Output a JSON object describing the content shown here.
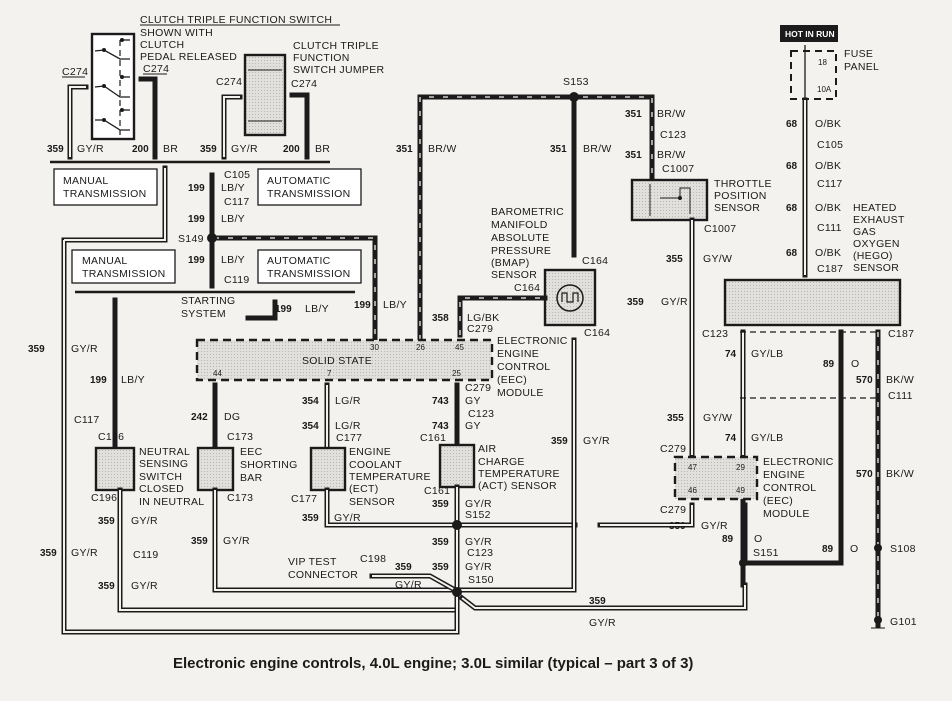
{
  "title": "Electronic engine controls, 4.0L engine; 3.0L similar (typical – part 3 of 3)",
  "hot_in_run": "HOT IN RUN",
  "fuse_panel": {
    "line1": "FUSE",
    "line2": "PANEL",
    "fuse_num": "18",
    "fuse_amps": "10A"
  },
  "clutch_switch": {
    "title": "CLUTCH TRIPLE FUNCTION SWITCH",
    "note": [
      "SHOWN WITH",
      "CLUTCH",
      "PEDAL RELEASED"
    ],
    "conn_left": "C274",
    "conn_right": "C274"
  },
  "clutch_jumper": {
    "title": [
      "CLUTCH TRIPLE",
      "FUNCTION",
      "SWITCH JUMPER"
    ],
    "conn_left": "C274",
    "conn_right": "C274"
  },
  "wires_top": {
    "w1_num": "359",
    "w1_color": "GY/R",
    "w2_num": "200",
    "w2_color": "BR",
    "w3_num": "359",
    "w3_color": "GY/R",
    "w4_num": "200",
    "w4_color": "BR"
  },
  "transmission_boxes": {
    "manual_1": [
      "MANUAL",
      "TRANSMISSION"
    ],
    "auto_1": [
      "AUTOMATIC",
      "TRANSMISSION"
    ],
    "manual_2": [
      "MANUAL",
      "TRANSMISSION"
    ],
    "auto_2": [
      "AUTOMATIC",
      "TRANSMISSION"
    ]
  },
  "circuit_199": {
    "num": "199",
    "color": "LB/Y",
    "c105": "C105",
    "c117": "C117",
    "s149": "S149",
    "c119": "C119",
    "starting_system": [
      "STARTING",
      "SYSTEM"
    ]
  },
  "circuit_351": {
    "num": "351",
    "color": "BR/W",
    "s153": "S153",
    "c123": "C123",
    "c1007": "C1007"
  },
  "bmap_sensor": {
    "label": [
      "BAROMETRIC",
      "MANIFOLD",
      "ABSOLUTE",
      "PRESSURE",
      "(BMAP)",
      "SENSOR"
    ],
    "conn_top": "C164",
    "conn_left": "C164",
    "conn_bottom": "C164",
    "wire_num": "358",
    "wire_color": "LG/BK",
    "c279": "C279"
  },
  "tps": {
    "label": [
      "THROTTLE",
      "POSITION",
      "SENSOR"
    ],
    "conn_top": "C1007",
    "conn_bottom": "C1007",
    "wire_num": "355",
    "wire_color": "GY/W",
    "wire2_num": "359",
    "wire2_color": "GY/R"
  },
  "hego": {
    "label": [
      "HEATED",
      "EXHAUST",
      "GAS",
      "OXYGEN",
      "(HEGO)",
      "SENSOR"
    ],
    "wire_num": "68",
    "wire_color": "O/BK",
    "c105": "C105",
    "c117": "C117",
    "c111": "C111",
    "c187": "C187"
  },
  "eec_main": {
    "inner": "SOLID STATE",
    "label": [
      "ELECTRONIC",
      "ENGINE",
      "CONTROL",
      "(EEC)",
      "MODULE"
    ],
    "pins": {
      "p30": "30",
      "p26": "26",
      "p45": "45",
      "p44": "44",
      "p7": "7",
      "p25": "25"
    },
    "c279": "C279"
  },
  "eec_right": {
    "label": [
      "ELECTRONIC",
      "ENGINE",
      "CONTROL",
      "(EEC)",
      "MODULE"
    ],
    "pins": {
      "p47": "47",
      "p29": "29",
      "p46": "46",
      "p49": "49"
    },
    "c279_top": "C279",
    "c279_bottom": "C279"
  },
  "right_wires": {
    "c123": "C123",
    "c187": "C187",
    "c111": "C111",
    "w74_num": "74",
    "w74_color": "GY/LB",
    "w89_num": "89",
    "w89_color": "O",
    "w570_num": "570",
    "w570_color": "BK/W",
    "w355_num": "355",
    "w355_color": "GY/W",
    "s151": "S151",
    "s108": "S108",
    "g101": "G101"
  },
  "neutral_switch": {
    "label": [
      "NEUTRAL",
      "SENSING",
      "SWITCH",
      "CLOSED",
      "IN NEUTRAL"
    ],
    "conn_top": "C196",
    "conn_bottom": "C196"
  },
  "shorting_bar": {
    "label": [
      "EEC",
      "SHORTING",
      "BAR"
    ],
    "conn_top": "C173",
    "conn_bottom": "C173",
    "wire_num": "242",
    "wire_color": "DG"
  },
  "ect": {
    "label": [
      "ENGINE",
      "COOLANT",
      "TEMPERATURE",
      "(ECT)",
      "SENSOR"
    ],
    "conn": "C177",
    "conn_bottom": "C177",
    "wire_num": "354",
    "wire_color": "LG/R"
  },
  "act": {
    "label": [
      "AIR",
      "CHARGE",
      "TEMPERATURE",
      "(ACT) SENSOR"
    ],
    "conn_top": "C161",
    "conn_bottom": "C161",
    "c279": "C279",
    "c123": "C123",
    "wire_num": "743",
    "wire_color": "GY"
  },
  "ground_net": {
    "num": "359",
    "color": "GY/R",
    "c117": "C117",
    "c119": "C119",
    "s152": "S152",
    "c123": "C123",
    "s150": "S150",
    "vip": [
      "VIP TEST",
      "CONNECTOR"
    ],
    "c198": "C198"
  }
}
